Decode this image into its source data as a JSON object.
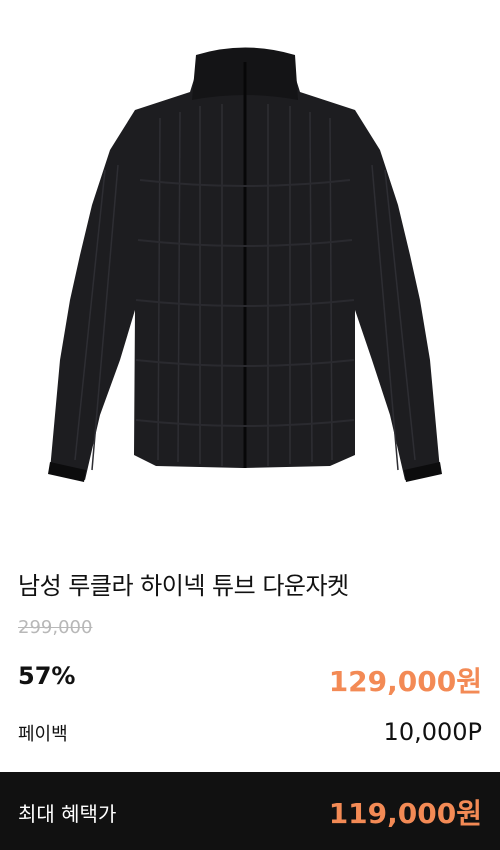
{
  "product": {
    "image_alt": "jacket-photo",
    "title": "남성 루클라 하이넥 튜브 다운자켓",
    "original_price": "299,000",
    "discount_rate": "57%",
    "sale_price": "129,000원",
    "paybak_label": "페이백",
    "paybak_value": "10,000P"
  },
  "footer": {
    "best_label": "최대 혜택가",
    "best_price": "119,000원"
  },
  "colors": {
    "accent": "#f38a55",
    "bar": "#111111"
  }
}
